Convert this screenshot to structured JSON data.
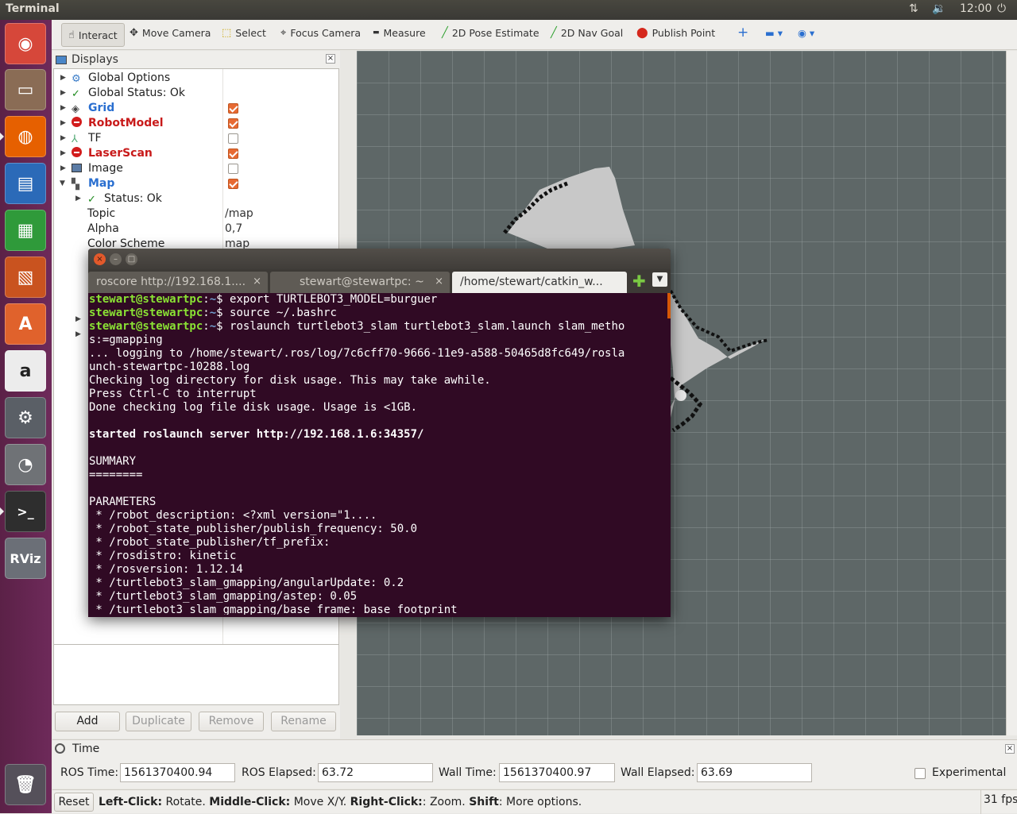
{
  "topbar": {
    "title": "Terminal",
    "clock": "12:00"
  },
  "launcher": {
    "items": [
      {
        "name": "ubuntu-dash-icon",
        "bg": "#d6473a",
        "glyph": "◉"
      },
      {
        "name": "files-icon",
        "bg": "#8a6c55",
        "glyph": "▭"
      },
      {
        "name": "firefox-icon",
        "bg": "#e66000",
        "glyph": "◍"
      },
      {
        "name": "writer-icon",
        "bg": "#2b6ab8",
        "glyph": "▤"
      },
      {
        "name": "calc-icon",
        "bg": "#2f9a3a",
        "glyph": "▦"
      },
      {
        "name": "impress-icon",
        "bg": "#c9531f",
        "glyph": "▧"
      },
      {
        "name": "software-center-icon",
        "bg": "#e0622c",
        "glyph": "A"
      },
      {
        "name": "amazon-icon",
        "bg": "#ececec",
        "glyph": "a"
      },
      {
        "name": "settings-icon",
        "bg": "#5a5f66",
        "glyph": "⚙"
      },
      {
        "name": "disk-usage-icon",
        "bg": "#6f7276",
        "glyph": "◔"
      },
      {
        "name": "terminal-icon",
        "bg": "#2e2e2e",
        "glyph": ">_"
      },
      {
        "name": "rviz-icon",
        "bg": "#6b6f77",
        "glyph": "RViz"
      },
      {
        "name": "trash-icon",
        "bg": "#55505a",
        "glyph": "🗑"
      }
    ]
  },
  "toolbar": {
    "tools": [
      {
        "key": "interact",
        "label": "Interact",
        "icon": "☝"
      },
      {
        "key": "move",
        "label": "Move Camera",
        "icon": "✥"
      },
      {
        "key": "select",
        "label": "Select",
        "icon": "⬚"
      },
      {
        "key": "focus",
        "label": "Focus Camera",
        "icon": "⌖"
      },
      {
        "key": "measure",
        "label": "Measure",
        "icon": "▬"
      },
      {
        "key": "pose",
        "label": "2D Pose Estimate",
        "icon": "╱"
      },
      {
        "key": "nav",
        "label": "2D Nav Goal",
        "icon": "╱"
      },
      {
        "key": "point",
        "label": "Publish Point",
        "icon": "⬤"
      }
    ],
    "plus": "+",
    "minus": "▬ ▾",
    "eye": "◉ ▾"
  },
  "displays": {
    "title": "Displays",
    "items": [
      {
        "label": "Global Options",
        "status": "gear"
      },
      {
        "label": "Global Status: Ok",
        "status": "ok"
      },
      {
        "label": "Grid",
        "status": "grid",
        "checked": true
      },
      {
        "label": "RobotModel",
        "status": "error",
        "checked": true
      },
      {
        "label": "TF",
        "status": "tf",
        "checked": false
      },
      {
        "label": "LaserScan",
        "status": "error",
        "checked": true
      },
      {
        "label": "Image",
        "status": "image",
        "checked": false
      },
      {
        "label": "Map",
        "status": "map",
        "checked": true
      }
    ],
    "sub": {
      "status": "Status: Ok",
      "props": [
        {
          "k": "Topic",
          "v": "/map"
        },
        {
          "k": "Alpha",
          "v": "0,7"
        },
        {
          "k": "Color Scheme",
          "v": "map"
        }
      ]
    },
    "buttons": {
      "add": "Add",
      "duplicate": "Duplicate",
      "remove": "Remove",
      "rename": "Rename"
    }
  },
  "time": {
    "title": "Time",
    "ros_time_label": "ROS Time:",
    "ros_time": "1561370400.94",
    "ros_elapsed_label": "ROS Elapsed:",
    "ros_elapsed": "63.72",
    "wall_time_label": "Wall Time:",
    "wall_time": "1561370400.97",
    "wall_elapsed_label": "Wall Elapsed:",
    "wall_elapsed": "63.69",
    "experimental": "Experimental"
  },
  "status": {
    "reset": "Reset",
    "hint_lc": "Left-Click:",
    "hint_lc_t": " Rotate. ",
    "hint_mc": "Middle-Click:",
    "hint_mc_t": " Move X/Y. ",
    "hint_rc": "Right-Click:",
    "hint_rc_t": ": Zoom. ",
    "hint_sh": "Shift",
    "hint_sh_t": ": More options.",
    "fps": "31 fps"
  },
  "terminal": {
    "tabs": [
      "roscore http://192.168.1....",
      "stewart@stewartpc: ~",
      "/home/stewart/catkin_w..."
    ],
    "prompt_user": "stewart@stewartpc",
    "lines": [
      {
        "t": "prompt",
        "cmd": "export TURTLEBOT3_MODEL=burguer"
      },
      {
        "t": "prompt",
        "cmd": "source ~/.bashrc"
      },
      {
        "t": "prompt",
        "cmd": "roslaunch turtlebot3_slam turtlebot3_slam.launch slam_metho"
      },
      {
        "t": "n",
        "v": "s:=gmapping"
      },
      {
        "t": "n",
        "v": "... logging to /home/stewart/.ros/log/7c6cff70-9666-11e9-a588-50465d8fc649/rosla"
      },
      {
        "t": "n",
        "v": "unch-stewartpc-10288.log"
      },
      {
        "t": "n",
        "v": "Checking log directory for disk usage. This may take awhile."
      },
      {
        "t": "n",
        "v": "Press Ctrl-C to interrupt"
      },
      {
        "t": "n",
        "v": "Done checking log file disk usage. Usage is <1GB."
      },
      {
        "t": "n",
        "v": ""
      },
      {
        "t": "b",
        "v": "started roslaunch server http://192.168.1.6:34357/"
      },
      {
        "t": "n",
        "v": ""
      },
      {
        "t": "n",
        "v": "SUMMARY"
      },
      {
        "t": "n",
        "v": "========"
      },
      {
        "t": "n",
        "v": ""
      },
      {
        "t": "n",
        "v": "PARAMETERS"
      },
      {
        "t": "n",
        "v": " * /robot_description: <?xml version=\"1...."
      },
      {
        "t": "n",
        "v": " * /robot_state_publisher/publish_frequency: 50.0"
      },
      {
        "t": "n",
        "v": " * /robot_state_publisher/tf_prefix:"
      },
      {
        "t": "n",
        "v": " * /rosdistro: kinetic"
      },
      {
        "t": "n",
        "v": " * /rosversion: 1.12.14"
      },
      {
        "t": "n",
        "v": " * /turtlebot3_slam_gmapping/angularUpdate: 0.2"
      },
      {
        "t": "n",
        "v": " * /turtlebot3_slam_gmapping/astep: 0.05"
      },
      {
        "t": "n",
        "v": " * /turtlebot3_slam_gmapping/base_frame: base_footprint"
      }
    ]
  }
}
